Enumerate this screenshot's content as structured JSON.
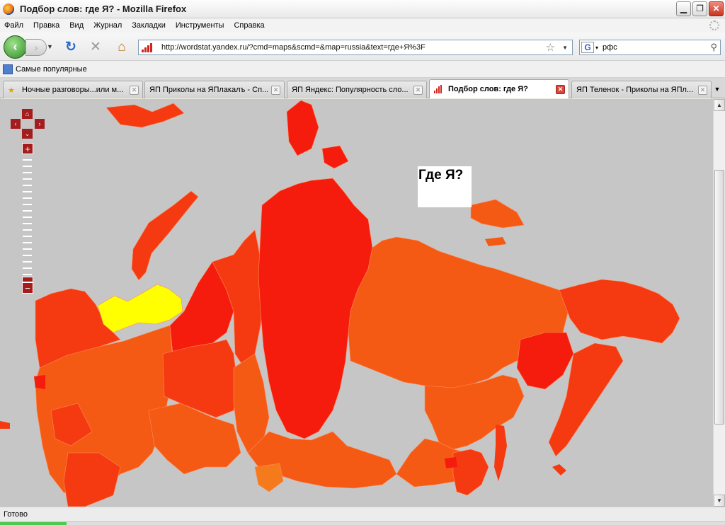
{
  "window": {
    "title": "Подбор слов: где Я? - Mozilla Firefox"
  },
  "menu": [
    "Файл",
    "Правка",
    "Вид",
    "Журнал",
    "Закладки",
    "Инструменты",
    "Справка"
  ],
  "nav": {
    "url": "http://wordstat.yandex.ru/?cmd=maps&scmd=&map=russia&text=где+Я%3F",
    "search_engine_letter": "G",
    "search_query": "рфс"
  },
  "bookmarks": {
    "item": "Самые популярные"
  },
  "tabs": [
    {
      "label": "Ночные разговоры...или м...",
      "icon": "star-icon",
      "active": false
    },
    {
      "label": "ЯП Приколы на ЯПлакалъ - Сп...",
      "icon": "yap-icon",
      "active": false
    },
    {
      "label": "ЯП Яндекс: Популярность сло...",
      "icon": "yap-icon",
      "active": false
    },
    {
      "label": "Подбор слов: где Я?",
      "icon": "wordstat-icon",
      "active": true
    },
    {
      "label": "ЯП Теленок - Приколы на ЯПл...",
      "icon": "yap-icon",
      "active": false
    }
  ],
  "map": {
    "query_label": "Где Я?",
    "colors": {
      "background": "#c6c6c6",
      "highest": "#f51c0d",
      "high": "#f53a12",
      "medium": "#f55a14",
      "low": "#f57a1c",
      "lowest": "#ffff00",
      "controls": "#a51c1c"
    }
  },
  "status": {
    "text": "Готово"
  }
}
